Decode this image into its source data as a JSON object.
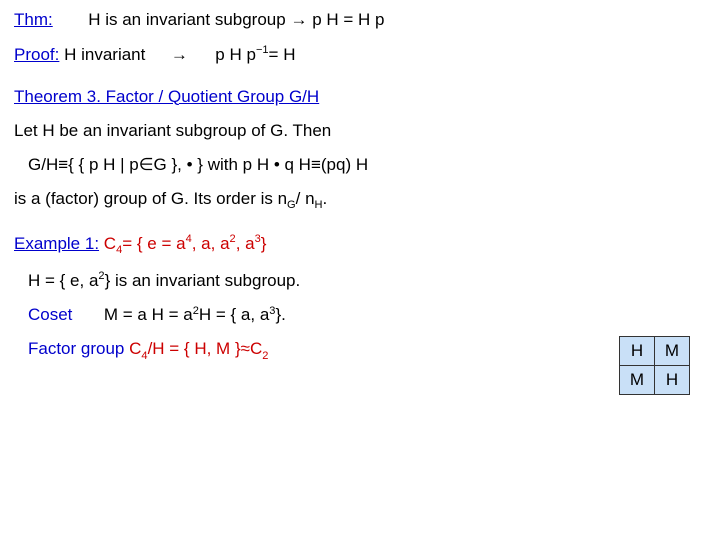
{
  "thm": {
    "label": "Thm:",
    "stmt_a": "H is an invariant subgroup ",
    "arrow": "→",
    "stmt_b": " p H = H p"
  },
  "proof": {
    "label": "Proof:",
    "lhs": " H invariant ",
    "arrow": "→",
    "rhs_a": " p H p",
    "rhs_exp": "−1",
    "rhs_b": " = H"
  },
  "thm3": {
    "heading": "Theorem 3.  Factor / Quotient Group G/H",
    "let": "Let H be an invariant subgroup of G.  Then",
    "def_a": "G/H ",
    "equiv": "≡",
    "def_b": " { { p H | p ",
    "inop": "∈",
    "def_c": " G }, • }   with    p H • q H ",
    "equiv2": "≡",
    "def_d": " (pq) H",
    "order_a": "is a (factor) group of G.     Its order is  n",
    "order_subG": "G",
    "order_mid": " / n",
    "order_subH": "H",
    "order_end": "."
  },
  "ex1": {
    "label": "Example 1:",
    "c4_name": "  C",
    "c4_sub": "4",
    "c4_eq": " = { e = a",
    "p4": "4",
    "c4_mid1": ", a, a",
    "p2": "2",
    "c4_mid2": ", a",
    "p3": "3",
    "c4_end": " }",
    "H_a": "H = { e, a",
    "H_b": " }  is an invariant subgroup.",
    "coset_label": "Coset",
    "coset_a": "M = a H = a",
    "coset_b": " H = { a, a",
    "coset_c": " }.",
    "fg_label": "Factor group   ",
    "fg_a": "C",
    "fg_b": "/H = { H, M } ",
    "approx": "≈",
    "fg_c": " C",
    "fg_sub2": "2"
  },
  "table": {
    "r0c0": "H",
    "r0c1": "M",
    "r1c0": "M",
    "r1c1": "H"
  }
}
